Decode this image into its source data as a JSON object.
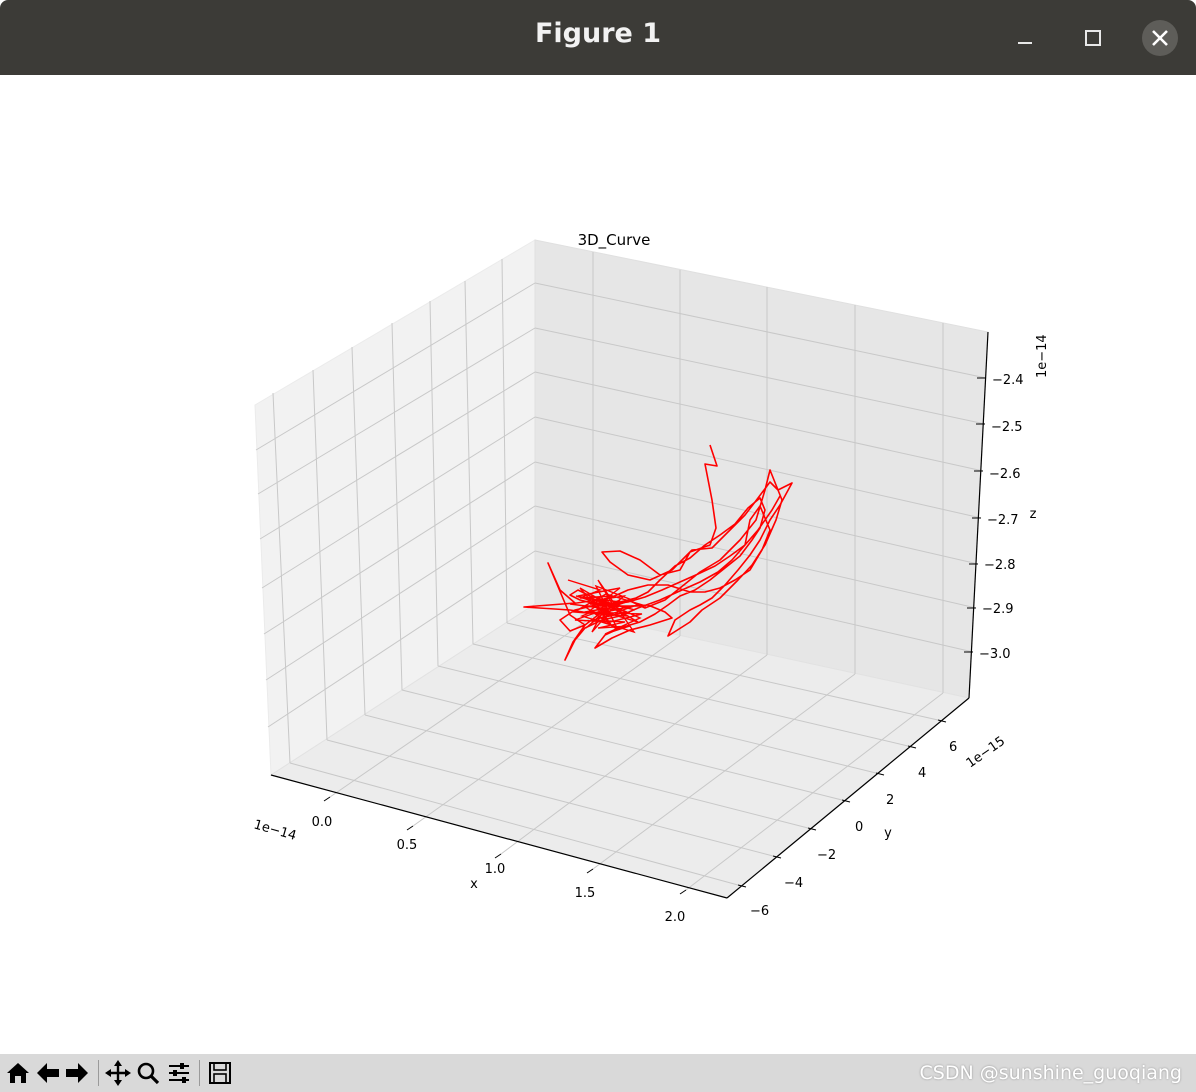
{
  "window": {
    "title": "Figure 1"
  },
  "toolbar": {
    "buttons": [
      "home-icon",
      "back-icon",
      "forward-icon",
      "pan-icon",
      "zoom-icon",
      "configure-icon",
      "save-icon"
    ],
    "watermark": "CSDN @sunshine_guoqiang"
  },
  "chart_data": {
    "type": "line3d",
    "title": "3D_Curve",
    "xlabel": "x",
    "ylabel": "y",
    "zlabel": "z",
    "x_offset_label": "1e−14",
    "y_offset_label": "1e−15",
    "z_offset_label": "1e−14",
    "x_ticks": [
      "0.0",
      "0.5",
      "1.0",
      "1.5",
      "2.0"
    ],
    "y_ticks": [
      "−6",
      "−4",
      "−2",
      "0",
      "2",
      "4",
      "6"
    ],
    "z_ticks": [
      "−2.4",
      "−2.5",
      "−2.6",
      "−2.7",
      "−2.8",
      "−2.9",
      "−3.0"
    ],
    "line_color": "#ff0000",
    "grid": true
  }
}
